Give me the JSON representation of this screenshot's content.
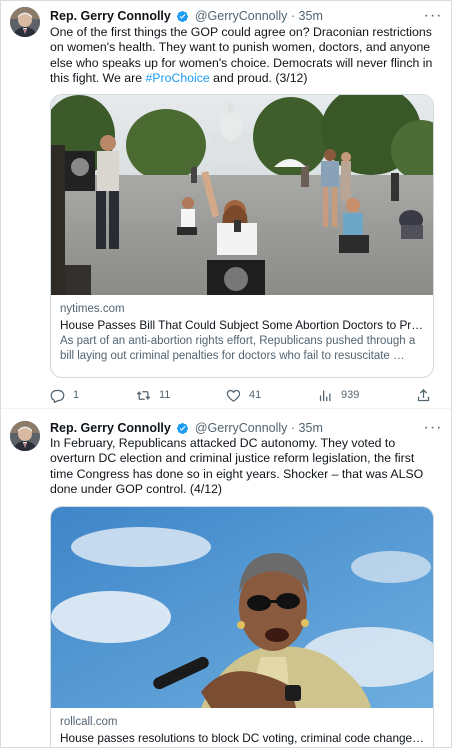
{
  "tweets": [
    {
      "author_name": "Rep. Gerry Connolly",
      "handle": "@GerryConnolly",
      "separator": "·",
      "time": "35m",
      "more_label": "···",
      "text_before": "One of the first things the GOP could agree on? Draconian restrictions on women's health. They want to punish women, doctors, and anyone else who speaks up for women's choice. Democrats will never flinch in this fight. We are ",
      "hashtag": "#ProChoice",
      "text_after": " and proud. (3/12)",
      "card": {
        "domain": "nytimes.com",
        "title": "House Passes Bill That Could Subject Some Abortion Doctors to Pros…",
        "description": "As part of an anti-abortion rights effort, Republicans pushed through a bill laying out criminal penalties for doctors who fail to resuscitate …"
      },
      "actions": {
        "replies": "1",
        "retweets": "11",
        "likes": "41",
        "views": "939"
      }
    },
    {
      "author_name": "Rep. Gerry Connolly",
      "handle": "@GerryConnolly",
      "separator": "·",
      "time": "35m",
      "more_label": "···",
      "text": "In February, Republicans attacked DC autonomy. They voted to overturn DC election and criminal justice reform legislation, the first time Congress has done so in eight years. Shocker – that was ALSO done under GOP control. (4/12)",
      "card": {
        "domain": "rollcall.com",
        "title": "House passes resolutions to block DC voting, criminal code changes …"
      }
    }
  ],
  "colors": {
    "link_blue": "#1d9bf0",
    "text_primary": "#0f1419",
    "text_secondary": "#536471",
    "border": "#cfd9de"
  },
  "icons": {
    "verified": "verified-badge-icon",
    "reply": "reply-icon",
    "retweet": "retweet-icon",
    "like": "heart-icon",
    "views": "bar-chart-icon",
    "share": "share-icon"
  }
}
